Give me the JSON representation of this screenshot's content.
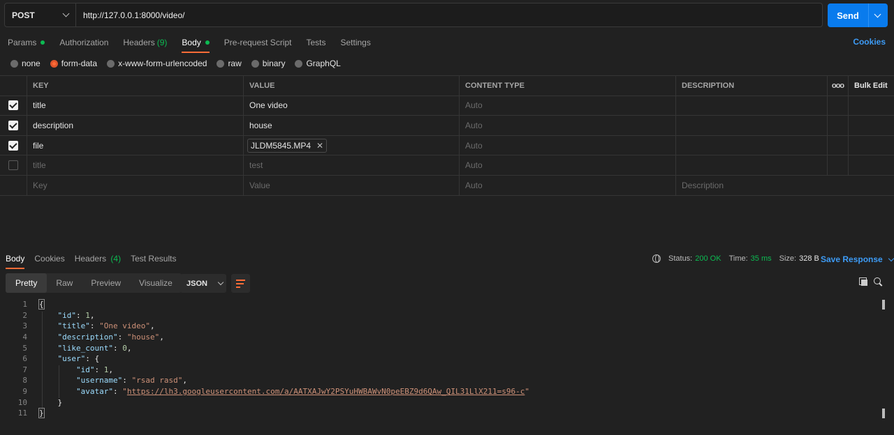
{
  "request": {
    "method": "POST",
    "url": "http://127.0.0.1:8000/video/",
    "send_label": "Send"
  },
  "request_tabs": [
    {
      "label": "Params",
      "indicator": "dot"
    },
    {
      "label": "Authorization"
    },
    {
      "label": "Headers",
      "count": "(9)"
    },
    {
      "label": "Body",
      "indicator": "dot",
      "active": true
    },
    {
      "label": "Pre-request Script"
    },
    {
      "label": "Tests"
    },
    {
      "label": "Settings"
    }
  ],
  "cookies_label": "Cookies",
  "body_types": [
    {
      "label": "none",
      "selected": false
    },
    {
      "label": "form-data",
      "selected": true
    },
    {
      "label": "x-www-form-urlencoded",
      "selected": false
    },
    {
      "label": "raw",
      "selected": false
    },
    {
      "label": "binary",
      "selected": false
    },
    {
      "label": "GraphQL",
      "selected": false
    }
  ],
  "table": {
    "headers": {
      "key": "KEY",
      "value": "VALUE",
      "content_type": "CONTENT TYPE",
      "description": "DESCRIPTION",
      "more": "ooo",
      "bulk_edit": "Bulk Edit"
    },
    "rows": [
      {
        "checked": true,
        "key": "title",
        "value": "One video",
        "content_type": "Auto"
      },
      {
        "checked": true,
        "key": "description",
        "value": "house",
        "content_type": "Auto"
      },
      {
        "checked": true,
        "key": "file",
        "value": "JLDM5845.MP4",
        "content_type": "Auto",
        "is_file": true
      },
      {
        "checked": false,
        "key": "title",
        "value": "test",
        "content_type": "Auto"
      }
    ],
    "placeholders": {
      "key": "Key",
      "value": "Value",
      "content_type": "Auto",
      "description": "Description"
    }
  },
  "response": {
    "tabs": {
      "body": "Body",
      "cookies": "Cookies",
      "headers": "Headers",
      "headers_count": "(4)",
      "test_results": "Test Results"
    },
    "status_label": "Status:",
    "status_value": "200 OK",
    "time_label": "Time:",
    "time_value": "35 ms",
    "size_label": "Size:",
    "size_value": "328 B",
    "save_label": "Save Response",
    "views": [
      "Pretty",
      "Raw",
      "Preview",
      "Visualize"
    ],
    "format": "JSON",
    "json": {
      "id": "1",
      "title": "\"One video\"",
      "description": "\"house\"",
      "like_count": "0",
      "user_id": "1",
      "username": "\"rsad rasd\"",
      "avatar": "https://lh3.googleusercontent.com/a/AATXAJwY2PSYuHWBAWvN0peEBZ9d6QAw_QIL31LlX211=s96-c"
    },
    "line_numbers": [
      "1",
      "2",
      "3",
      "4",
      "5",
      "6",
      "7",
      "8",
      "9",
      "10",
      "11"
    ]
  },
  "colors": {
    "accent": "#ff6c37",
    "primary": "#097bed",
    "success": "#0cbb52",
    "link": "#3d9bf5"
  }
}
